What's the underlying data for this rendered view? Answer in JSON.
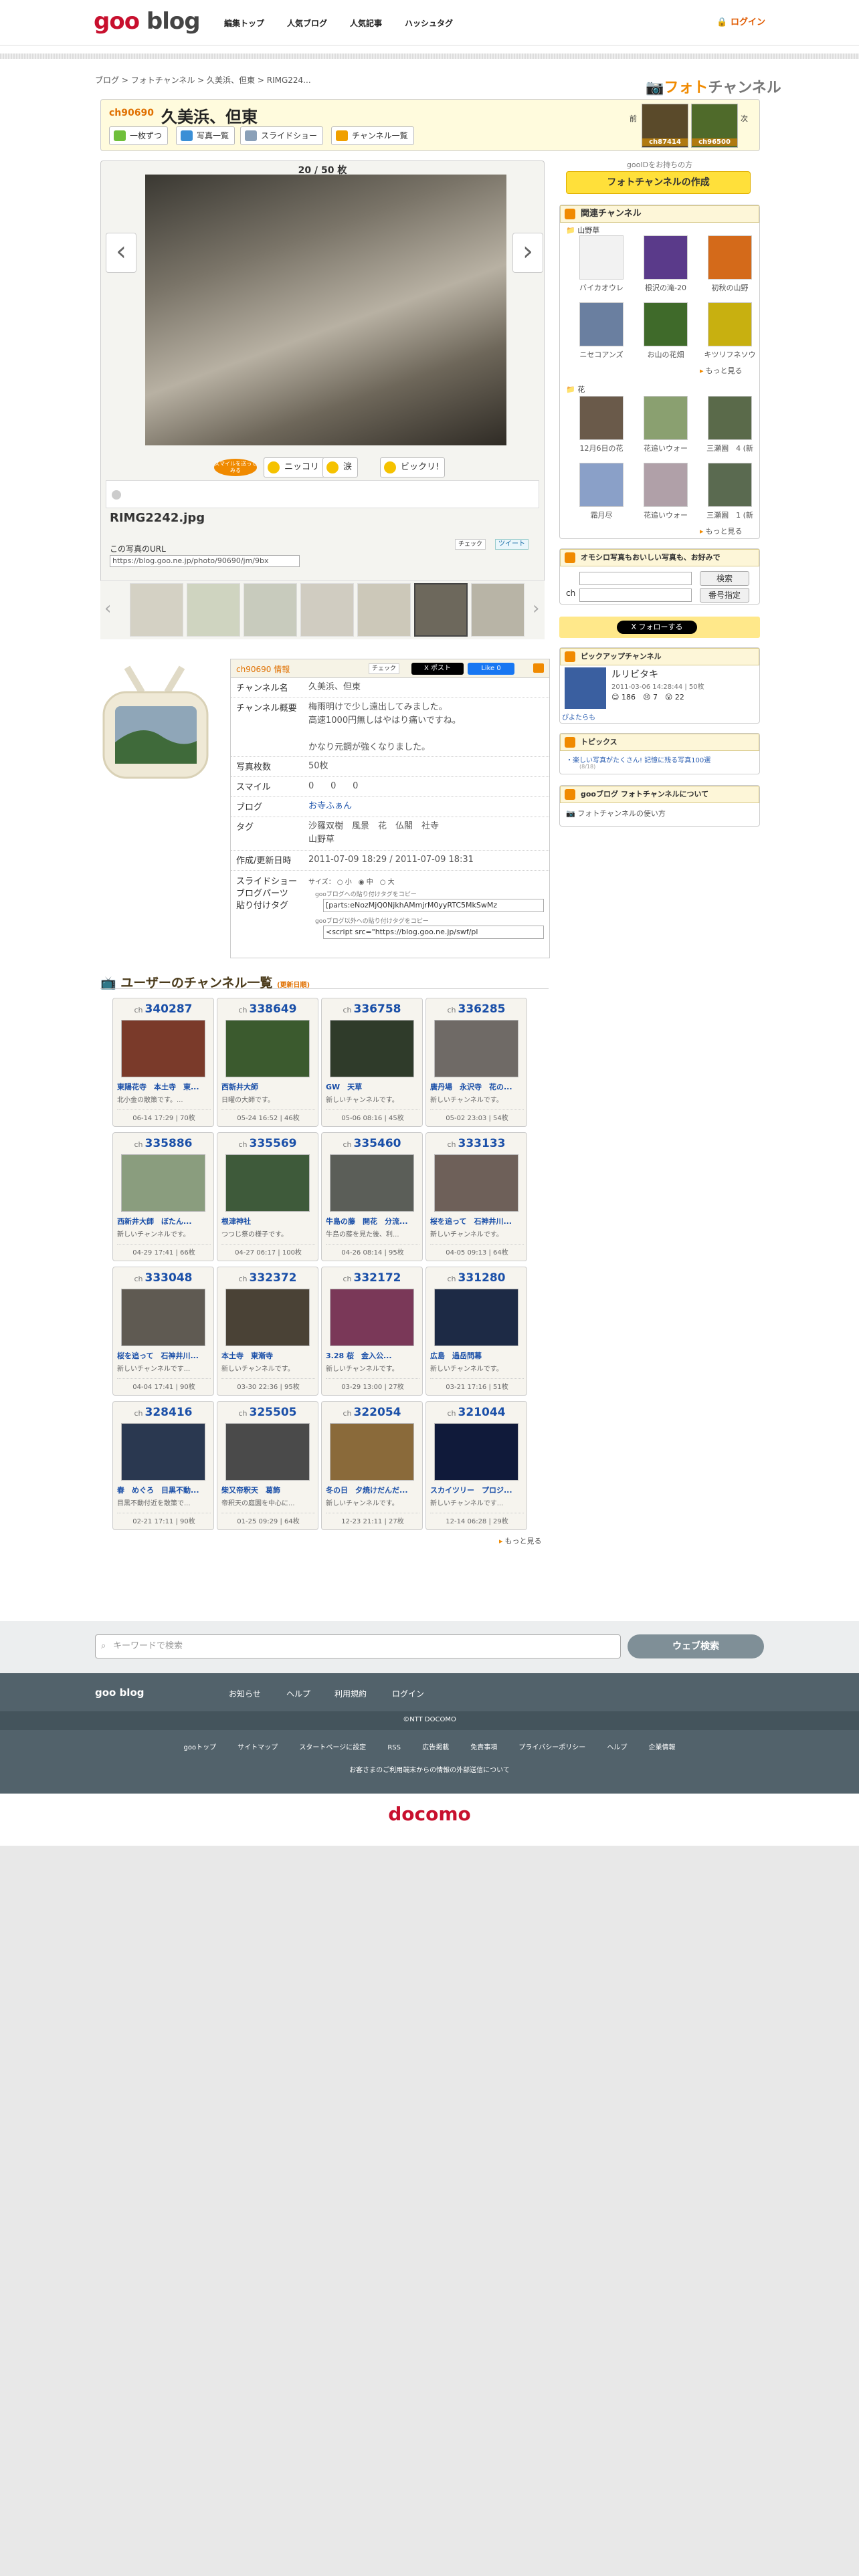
{
  "header": {
    "logo_goo": "goo",
    "logo_blog": "blog",
    "nav": [
      "編集トップ",
      "人気ブログ",
      "人気記事",
      "ハッシュタグ"
    ],
    "login": "ログイン"
  },
  "breadcrumb": [
    "ブログ",
    "フォトチャンネル",
    "久美浜、但東",
    "RIMG224..."
  ],
  "foto_logo": {
    "a": "フォト",
    "b": "チャンネル"
  },
  "channel": {
    "id": "ch90690",
    "title": "久美浜、但東",
    "btn_each": "一枚ずつ",
    "btn_list": "写真一覧",
    "btn_slide": "スライドショー",
    "btn_chlist": "チャンネル一覧",
    "prev_label": "前",
    "next_label": "次",
    "prev_id": "ch87414",
    "next_id": "ch96500"
  },
  "photo": {
    "counter": "20 / 50 枚",
    "filename": "RIMG2242.jpg",
    "url_label": "この写真のURL",
    "url": "https://blog.goo.ne.jp/photo/90690/jm/9bx",
    "check": "チェック",
    "tweet": "ツイート",
    "react": [
      "ニッコリ",
      "涙",
      "ビックリ!"
    ],
    "react_label": "スマイルを送ってみる"
  },
  "right": {
    "note": "gooIDをお持ちの方",
    "create_btn": "フォトチャンネルの作成",
    "related_h": "関連チャンネル",
    "cat1": "山野草",
    "cat1_items": [
      "バイカオウレ",
      "根沢の滝-20",
      "初秋の山野",
      "ニセコアンズ",
      "お山の花畑",
      "キツリフネソウ"
    ],
    "cat1_alt": "バイカオウレン",
    "cat2": "花",
    "cat2_items": [
      "12月6日の花",
      "花追いウォー",
      "三瀬園　4 (新",
      "霜月尽",
      "花追いウォー",
      "三瀬園　1 (新"
    ],
    "more": "もっと見る",
    "search_h": "オモシロ写真もおいしい写真も、お好みで",
    "search_btn": "検索",
    "number_btn": "番号指定",
    "ch": "ch",
    "follow": "フォローする",
    "pickup_h": "ピックアップチャンネル",
    "pickup_title": "ルリビタキ",
    "pickup_meta": "2011-03-06 14:28:44 | 50枚",
    "pickup_counts": [
      "186",
      "7",
      "22"
    ],
    "pickup_user": "ぴよたらも",
    "topics_h": "トピックス",
    "topics_item": "楽しい写真がたくさん! 記憶に残る写真100選",
    "topics_date": "(8/18)",
    "about_h": "gooブログ フォトチャンネルについて",
    "about_link": "フォトチャンネルの使い方"
  },
  "info": {
    "head": "ch90690 情報",
    "rows": [
      {
        "label": "チャンネル名",
        "value": "久美浜、但東"
      },
      {
        "label": "チャンネル概要",
        "value": "梅雨明けで少し遠出してみました。\n高速1000円無しはやはり痛いですね。\n\nかなり元鋼が強くなりました。"
      },
      {
        "label": "写真枚数",
        "value": "50枚"
      },
      {
        "label": "スマイル",
        "value": "0      0      0"
      },
      {
        "label": "ブログ",
        "value": "お寺ふぁん"
      },
      {
        "label": "タグ",
        "value": "沙羅双樹　風景　花　仏閣　社寺\n山野草"
      },
      {
        "label": "作成/更新日時",
        "value": "2011-07-09 18:29 / 2011-07-09 18:31"
      }
    ],
    "slideshow_label": "スライドショー\nブログパーツ\n貼り付けタグ",
    "size_label": "サイズ：",
    "size_opts": [
      "小",
      "中",
      "大"
    ],
    "tag1_label": "gooブログへの貼り付けタグをコピー",
    "tag1": "[parts:eNozMjQ0NjkhAMmjrM0yyRTC5MkSwMz",
    "tag2_label": "gooブログ以外への貼り付けタグをコピー",
    "tag2": "<script src=\"https://blog.goo.ne.jp/swf/pl"
  },
  "user_list_h": "ユーザーのチャンネル一覧",
  "user_list_sub": "(更新日順)",
  "cards": [
    {
      "id": "340287",
      "title": "東陽花寺　本土寺　東...",
      "desc": "北小金の散策です。...",
      "meta": "06-14 17:29 | 70枚"
    },
    {
      "id": "338649",
      "title": "西新井大師",
      "desc": "日曜の大師です。",
      "meta": "05-24 16:52 | 46枚"
    },
    {
      "id": "336758",
      "title": "GW　天草",
      "desc": "新しいチャンネルです。",
      "meta": "05-06 08:16 | 45枚"
    },
    {
      "id": "336285",
      "title": "唐丹場　永沢寺　花の...",
      "desc": "新しいチャンネルです。",
      "meta": "05-02 23:03 | 54枚"
    },
    {
      "id": "335886",
      "title": "西新井大師　ぼたん...",
      "desc": "新しいチャンネルです。",
      "meta": "04-29 17:41 | 66枚"
    },
    {
      "id": "335569",
      "title": "根津神社",
      "desc": "つつじ祭の様子です。",
      "meta": "04-27 06:17 | 100枚"
    },
    {
      "id": "335460",
      "title": "牛島の藤　開花　分流...",
      "desc": "牛島の藤を見た後、利...",
      "meta": "04-26 08:14 | 95枚"
    },
    {
      "id": "333133",
      "title": "桜を追って　石神井川...",
      "desc": "新しいチャンネルです。",
      "meta": "04-05 09:13 | 64枚"
    },
    {
      "id": "333048",
      "title": "桜を追って　石神井川...",
      "desc": "新しいチャンネルです...",
      "meta": "04-04 17:41 | 90枚"
    },
    {
      "id": "332372",
      "title": "本土寺　東漸寺",
      "desc": "新しいチャンネルです。",
      "meta": "03-30 22:36 | 95枚"
    },
    {
      "id": "332172",
      "title": "3.28 桜　金入公...",
      "desc": "新しいチャンネルです。",
      "meta": "03-29 13:00 | 27枚"
    },
    {
      "id": "331280",
      "title": "広島　過岳問幕",
      "desc": "新しいチャンネルです。",
      "meta": "03-21 17:16 | 51枚"
    },
    {
      "id": "328416",
      "title": "春　めぐろ　目黒不動...",
      "desc": "目黒不動付近を散策で...",
      "meta": "02-21 17:11 | 90枚"
    },
    {
      "id": "325505",
      "title": "柴又帝釈天　葛飾",
      "desc": "帝釈天の庭園を中心に...",
      "meta": "01-25 09:29 | 64枚"
    },
    {
      "id": "322054",
      "title": "冬の日　夕焼けだんだ...",
      "desc": "新しいチャンネルです。",
      "meta": "12-23 21:11 | 27枚"
    },
    {
      "id": "321044",
      "title": "スカイツリー　プロジ...",
      "desc": "新しいチャンネルです...",
      "meta": "12-14 06:28 | 29枚"
    }
  ],
  "more_bottom": "もっと見る",
  "footer": {
    "search_placeholder": "キーワードで検索",
    "search_btn": "ウェブ検索",
    "logo": "goo blog",
    "links": [
      "お知らせ",
      "ヘルプ",
      "利用規約",
      "ログイン"
    ],
    "copyright": "©NTT DOCOMO",
    "links2": [
      "gooトップ",
      "サイトマップ",
      "スタートページに設定",
      "RSS",
      "広告掲載",
      "免責事項",
      "プライバシーポリシー",
      "ヘルプ",
      "企業情報"
    ],
    "notice": "お客さまのご利用端末からの情報の外部送信について",
    "docomo": "docomo"
  }
}
